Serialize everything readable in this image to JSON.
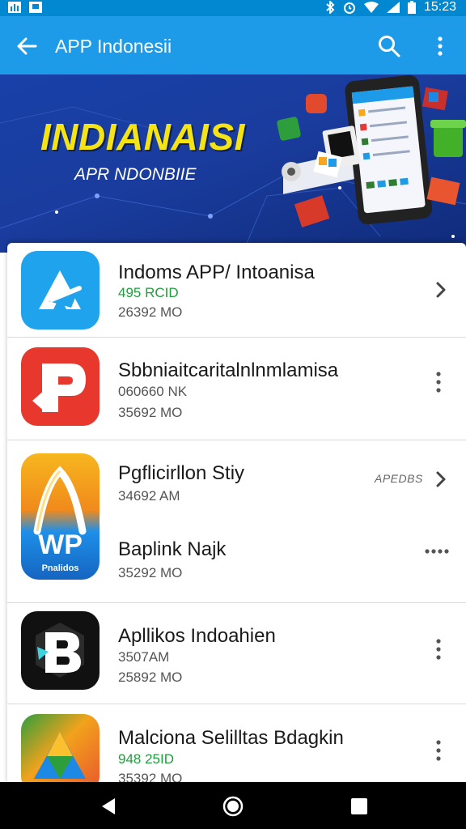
{
  "status_bar": {
    "time": "15:23"
  },
  "app_bar": {
    "title": "APP Indonesii"
  },
  "banner": {
    "headline": "INDIANAISI",
    "subline": "APR NDONBIIE"
  },
  "apps": [
    {
      "name": "Indoms APP/ Intoanisa",
      "line1": "495 RCID",
      "line2": "26392 MO"
    },
    {
      "name": "Sbbniaitcaritalnlnmlamisa",
      "line1": "060660 NK",
      "line2": "35692 MO"
    },
    {
      "name": "Pgflicirllon Stiy",
      "line1": "34692 AM",
      "side_label": "APEDBS"
    },
    {
      "name": "Baplink Najk",
      "line1": "35292 MO",
      "icon_text": "WP",
      "icon_caption": "Pnalidos"
    },
    {
      "name": "Apllikos Indoahien",
      "line1": "3507AM",
      "line2": "25892 MO",
      "icon_text": "B"
    },
    {
      "name": "Malciona Selilltas Bdagkin",
      "line1": "948 25ID",
      "line2": "35392 MO"
    }
  ],
  "colors": {
    "status_bar": "#0288d1",
    "app_bar": "#1e9be8",
    "banner": "#1a3c9e",
    "headline": "#f4e315",
    "green_meta": "#1f9e3c"
  },
  "icons": [
    "back-arrow",
    "search",
    "more-vert",
    "chevron-right",
    "more-horiz",
    "nav-back",
    "nav-home",
    "nav-recents"
  ]
}
